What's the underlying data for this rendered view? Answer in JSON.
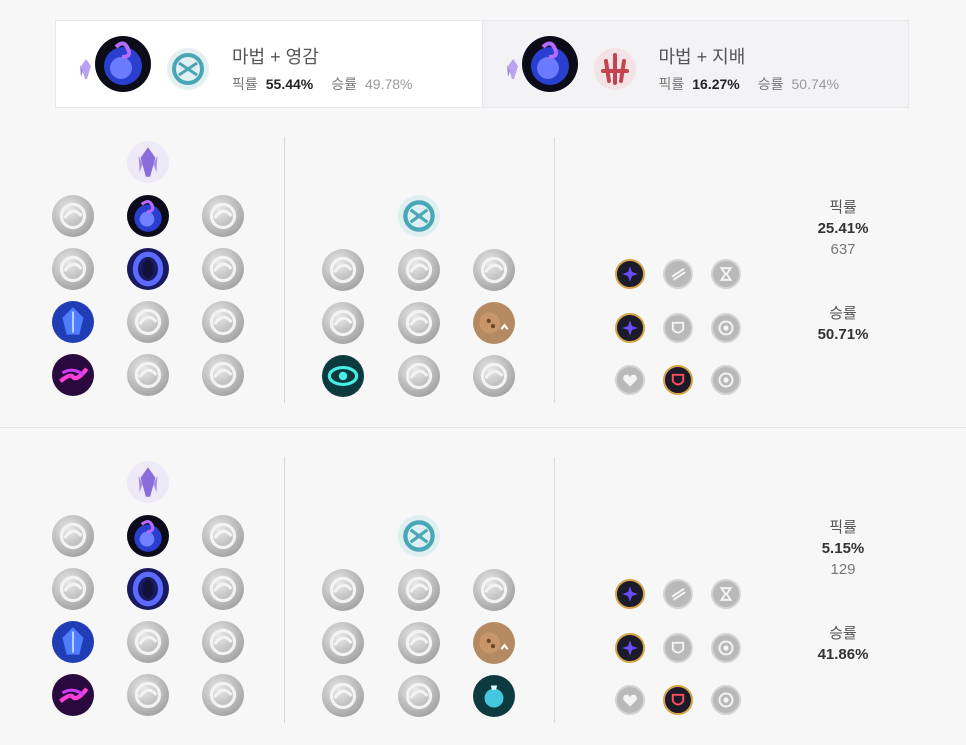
{
  "tabs": [
    {
      "title": "마법 + 영감",
      "pick_label": "픽률",
      "pick_value": "55.44%",
      "win_label": "승률",
      "win_value": "49.78%",
      "key_icon": "arcane-comet-icon",
      "secondary_icon": "inspiration-tree-icon"
    },
    {
      "title": "마법 + 지배",
      "pick_label": "픽률",
      "pick_value": "16.27%",
      "win_label": "승률",
      "win_value": "50.74%",
      "key_icon": "arcane-comet-icon",
      "secondary_icon": "domination-tree-icon"
    }
  ],
  "builds": [
    {
      "primary_tree": "sorcery",
      "primary_rows": [
        [
          "summon-aery",
          "arcane-comet",
          "phase-rush"
        ],
        [
          "nullifying-orb",
          "manaflow-band",
          "nimbus-cloak"
        ],
        [
          "transcendence",
          "celerity",
          "absolute-focus"
        ],
        [
          "scorch",
          "waterwalking",
          "gathering-storm"
        ]
      ],
      "primary_selected": [
        1,
        1,
        0,
        0
      ],
      "secondary_tree": "inspiration",
      "secondary_rows": [
        [
          "hextech-flashtraption",
          "magical-footwear",
          "perfect-timing"
        ],
        [
          "future-market",
          "minion-dematerializer",
          "biscuit-delivery"
        ],
        [
          "cosmic-insight",
          "approach-velocity",
          "time-warp-tonic"
        ]
      ],
      "secondary_selected": [
        -1,
        2,
        0
      ],
      "shards": [
        [
          "adaptive-force",
          "attack-speed",
          "ability-haste"
        ],
        [
          "adaptive-force",
          "armor",
          "magic-resist"
        ],
        [
          "health",
          "armor",
          "magic-resist"
        ]
      ],
      "shards_selected": [
        0,
        0,
        1
      ],
      "pick_label": "픽률",
      "pick_value": "25.41%",
      "games": "637",
      "win_label": "승률",
      "win_value": "50.71%"
    },
    {
      "primary_tree": "sorcery",
      "primary_rows": [
        [
          "summon-aery",
          "arcane-comet",
          "phase-rush"
        ],
        [
          "nullifying-orb",
          "manaflow-band",
          "nimbus-cloak"
        ],
        [
          "transcendence",
          "celerity",
          "absolute-focus"
        ],
        [
          "scorch",
          "waterwalking",
          "gathering-storm"
        ]
      ],
      "primary_selected": [
        1,
        1,
        0,
        0
      ],
      "secondary_tree": "inspiration",
      "secondary_rows": [
        [
          "hextech-flashtraption",
          "magical-footwear",
          "perfect-timing"
        ],
        [
          "future-market",
          "minion-dematerializer",
          "biscuit-delivery"
        ],
        [
          "cosmic-insight",
          "approach-velocity",
          "time-warp-tonic"
        ]
      ],
      "secondary_selected": [
        -1,
        2,
        2
      ],
      "shards": [
        [
          "adaptive-force",
          "attack-speed",
          "ability-haste"
        ],
        [
          "adaptive-force",
          "armor",
          "magic-resist"
        ],
        [
          "health",
          "armor",
          "magic-resist"
        ]
      ],
      "shards_selected": [
        0,
        0,
        1
      ],
      "pick_label": "픽률",
      "pick_value": "5.15%",
      "games": "129",
      "win_label": "승률",
      "win_value": "41.86%"
    }
  ],
  "colors": {
    "sorcery": "#8a6bd8",
    "comet": "#2a3fd0",
    "inspiration": "#49a6b5",
    "domination": "#c4434f",
    "shard_border": "#d6a24a"
  }
}
